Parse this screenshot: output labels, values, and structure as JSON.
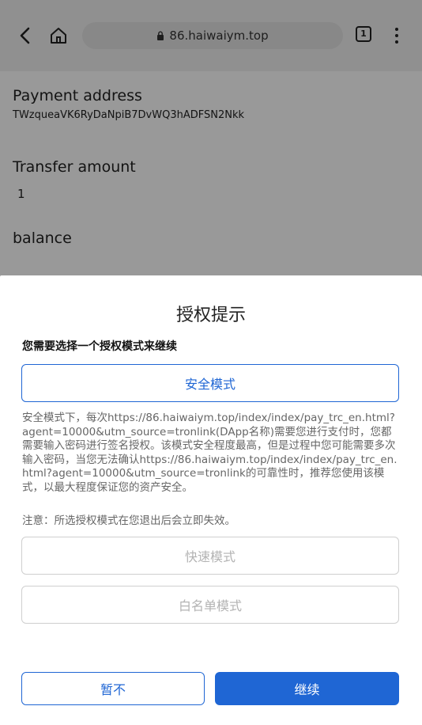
{
  "browser": {
    "url": "86.haiwaiym.top",
    "tab_count": "1"
  },
  "page": {
    "payment_address_label": "Payment address",
    "payment_address_value": "TWzqueaVK6RyDaNpiB7DvWQ3hADFSN2Nkk",
    "transfer_amount_label": "Transfer amount",
    "transfer_amount_value": "1",
    "balance_label": "balance"
  },
  "dialog": {
    "title": "授权提示",
    "subtitle": "您需要选择一个授权模式来继续",
    "secure_mode": "安全模式",
    "secure_description": "安全模式下，每次https://86.haiwaiym.top/index/index/pay_trc_en.html?agent=10000&utm_source=tronlink(DApp名称)需要您进行支付时，您都需要输入密码进行签名授权。该模式安全程度最高，但是过程中您可能需要多次输入密码，当您无法确认https://86.haiwaiym.top/index/index/pay_trc_en.html?agent=10000&utm_source=tronlink的可靠性时，推荐您使用该模式，以最大程度保证您的资产安全。",
    "note": "注意：所选授权模式在您退出后会立即失效。",
    "fast_mode": "快速模式",
    "whitelist_mode": "白名单模式",
    "cancel_button": "暂不",
    "continue_button": "继续"
  },
  "colors": {
    "accent": "#1f66d4",
    "overlay": "rgba(0,0,0,0.40)"
  }
}
